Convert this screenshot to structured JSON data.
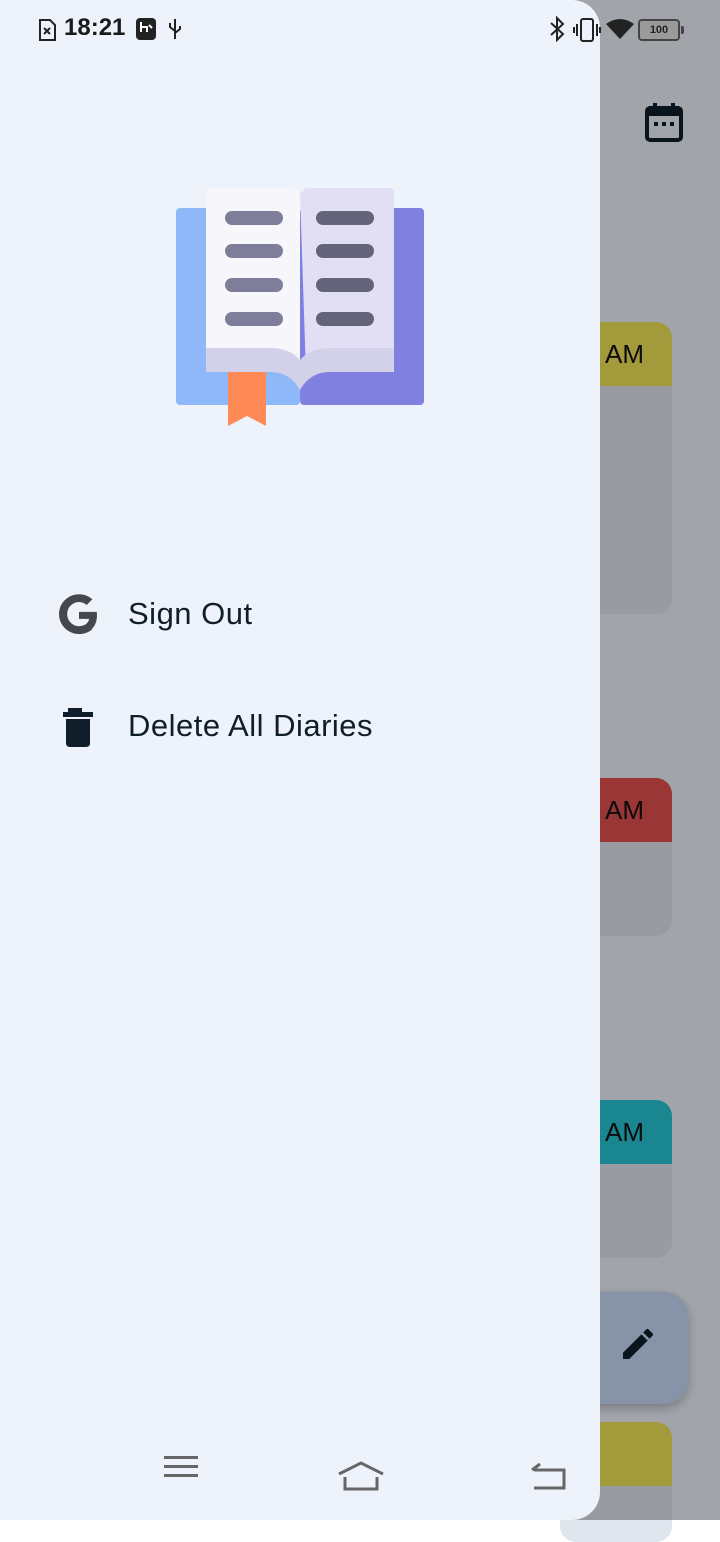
{
  "status_bar": {
    "time": "18:21",
    "battery": "100",
    "icons": [
      "sim-error-icon",
      "usb-debug-icon",
      "usb-icon",
      "bluetooth-icon",
      "vibrate-icon",
      "wifi-icon",
      "battery-icon"
    ]
  },
  "background": {
    "cards": [
      {
        "time_suffix": "AM",
        "color": "#f0e357"
      },
      {
        "time_suffix": "AM",
        "color": "#e55050"
      },
      {
        "time_suffix": "AM",
        "color": "#25c6d4"
      },
      {
        "time_suffix": "",
        "color": "#f0e357"
      }
    ],
    "fab_icon": "edit-icon",
    "toolbar_icon": "calendar-icon"
  },
  "drawer": {
    "header_image": "open-book-illustration",
    "items": [
      {
        "icon": "google-icon",
        "label": "Sign Out"
      },
      {
        "icon": "trash-icon",
        "label": "Delete All Diaries"
      }
    ]
  },
  "nav_bar": {
    "buttons": [
      "menu-icon",
      "home-icon",
      "back-icon"
    ]
  }
}
